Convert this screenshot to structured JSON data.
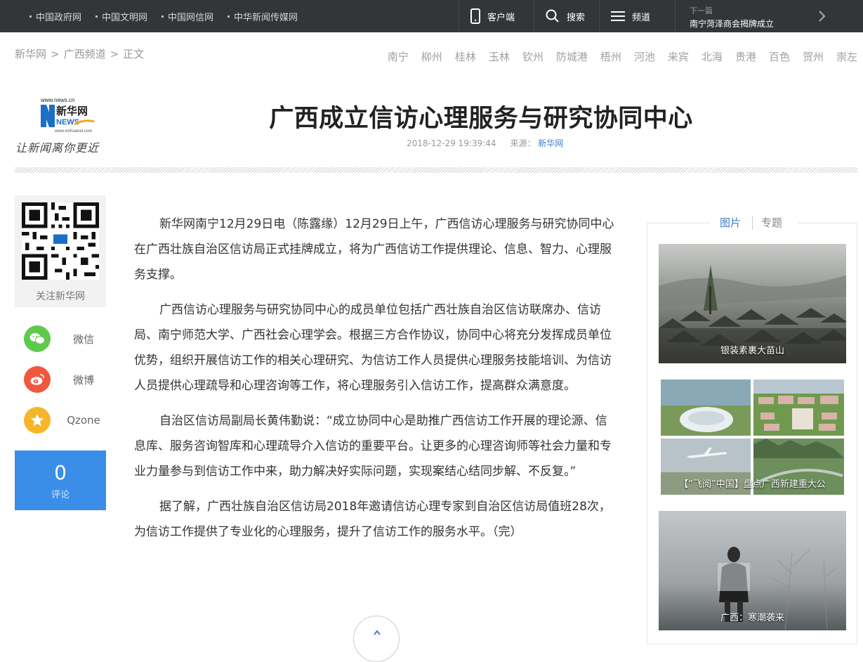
{
  "topbar": {
    "links": [
      "中国政府网",
      "中国文明网",
      "中国网信网",
      "中华新闻传媒网"
    ],
    "client_label": "客户端",
    "search_label": "搜索",
    "channel_label": "频道",
    "next_caption": "下一篇",
    "next_title": "南宁菏泽商会揭牌成立"
  },
  "breadcrumb": [
    "新华网",
    "广西频道",
    "正文"
  ],
  "cities": [
    "南宁",
    "柳州",
    "桂林",
    "玉林",
    "钦州",
    "防城港",
    "梧州",
    "河池",
    "来宾",
    "北海",
    "贵港",
    "百色",
    "贺州",
    "崇左"
  ],
  "logo": {
    "url_text": "www.news.cn",
    "brand": "新华网",
    "news": "NEWS",
    "sub_url": "www.xinhuanet.com",
    "slogan": "让新闻离你更近"
  },
  "article": {
    "title": "广西成立信访心理服务与研究协同中心",
    "datetime": "2018-12-29 19:39:44",
    "source_label": "来源：",
    "source": "新华网",
    "paragraphs": [
      "新华网南宁12月29日电（陈露缘）12月29日上午，广西信访心理服务与研究协同中心在广西壮族自治区信访局正式挂牌成立，将为广西信访工作提供理论、信息、智力、心理服务支撑。",
      "广西信访心理服务与研究协同中心的成员单位包括广西壮族自治区信访联席办、信访局、南宁师范大学、广西社会心理学会。根据三方合作协议，协同中心将充分发挥成员单位优势，组织开展信访工作的相关心理研究、为信访工作人员提供心理服务技能培训、为信访人员提供心理疏导和心理咨询等工作，将心理服务引入信访工作，提高群众满意度。",
      "自治区信访局副局长黄伟勤说：“成立协同中心是助推广西信访工作开展的理论源、信息库、服务咨询智库和心理疏导介入信访的重要平台。让更多的心理咨询师等社会力量和专业力量参与到信访工作中来，助力解决好实际问题，实现案结心结同步解、不反复。”",
      "据了解，广西壮族自治区信访局2018年邀请信访心理专家到自治区信访局值班28次，为信访工作提供了专业化的心理服务，提升了信访工作的服务水平。（完）"
    ]
  },
  "sidebar": {
    "qr_caption": "关注新华网",
    "share": [
      {
        "label": "微信",
        "color": "#5fc94c"
      },
      {
        "label": "微博",
        "color": "#f0573e"
      },
      {
        "label": "Qzone",
        "color": "#f7b52a"
      }
    ],
    "comment_count": "0",
    "comment_label": "评论"
  },
  "right": {
    "tabs": [
      "图片",
      "专题"
    ],
    "pictures": [
      {
        "caption": "银装素裹大苗山"
      },
      {
        "caption": "【“飞阅”中国】盘点广西新建重大公"
      },
      {
        "caption": "广西：寒潮袭来"
      }
    ]
  },
  "colors": {
    "topbar": "#333539",
    "accent": "#3f7ec9",
    "comment": "#3b8ee8"
  }
}
